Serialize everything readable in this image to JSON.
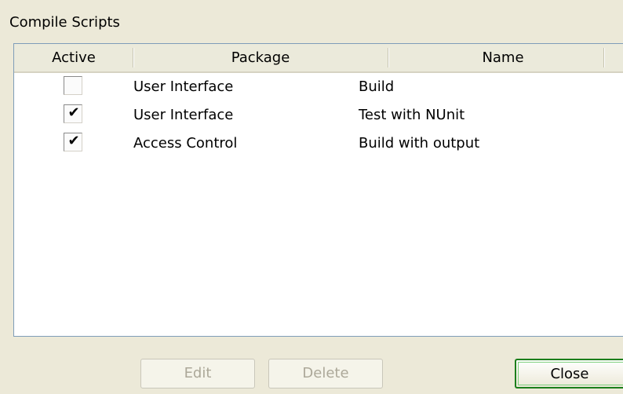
{
  "dialog": {
    "title": "Compile Scripts"
  },
  "table": {
    "columns": [
      "Active",
      "Package",
      "Name"
    ],
    "rows": [
      {
        "active": false,
        "package": "User Interface",
        "name": "Build"
      },
      {
        "active": true,
        "package": "User Interface",
        "name": "Test with NUnit"
      },
      {
        "active": true,
        "package": "Access Control",
        "name": "Build with output"
      }
    ]
  },
  "buttons": {
    "edit_label": "Edit",
    "edit_enabled": false,
    "delete_label": "Delete",
    "delete_enabled": false,
    "close_label": "Close"
  },
  "colors": {
    "window_bg": "#ece9d8",
    "list_border": "#7f9db9",
    "default_button_border": "#1b7e1b",
    "disabled_text": "#aca899"
  },
  "icons": {
    "checked": "checkmark-icon"
  }
}
